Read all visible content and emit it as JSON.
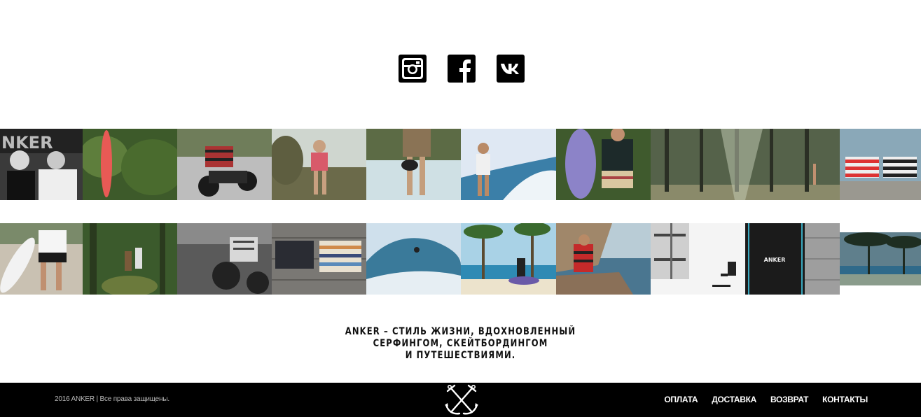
{
  "social": [
    {
      "name": "instagram",
      "icon": "instagram-icon"
    },
    {
      "name": "facebook",
      "icon": "facebook-icon"
    },
    {
      "name": "vk",
      "icon": "vk-icon"
    }
  ],
  "tagline": {
    "line1": "ANKER – СТИЛЬ ЖИЗНИ, ВДОХНОВЛЕННЫЙ",
    "line2": "СЕРФИНГОМ, СКЕЙТБОРДИНГОМ",
    "line3": "И ПУТЕШЕСТВИЯМИ."
  },
  "footer": {
    "copyright": "2016 ANKER | Все права защищены.",
    "logo_icon": "anchor-logo-icon",
    "nav": [
      "ОПЛАТА",
      "ДОСТАВКА",
      "ВОЗВРАТ",
      "КОНТАКТЫ"
    ]
  }
}
